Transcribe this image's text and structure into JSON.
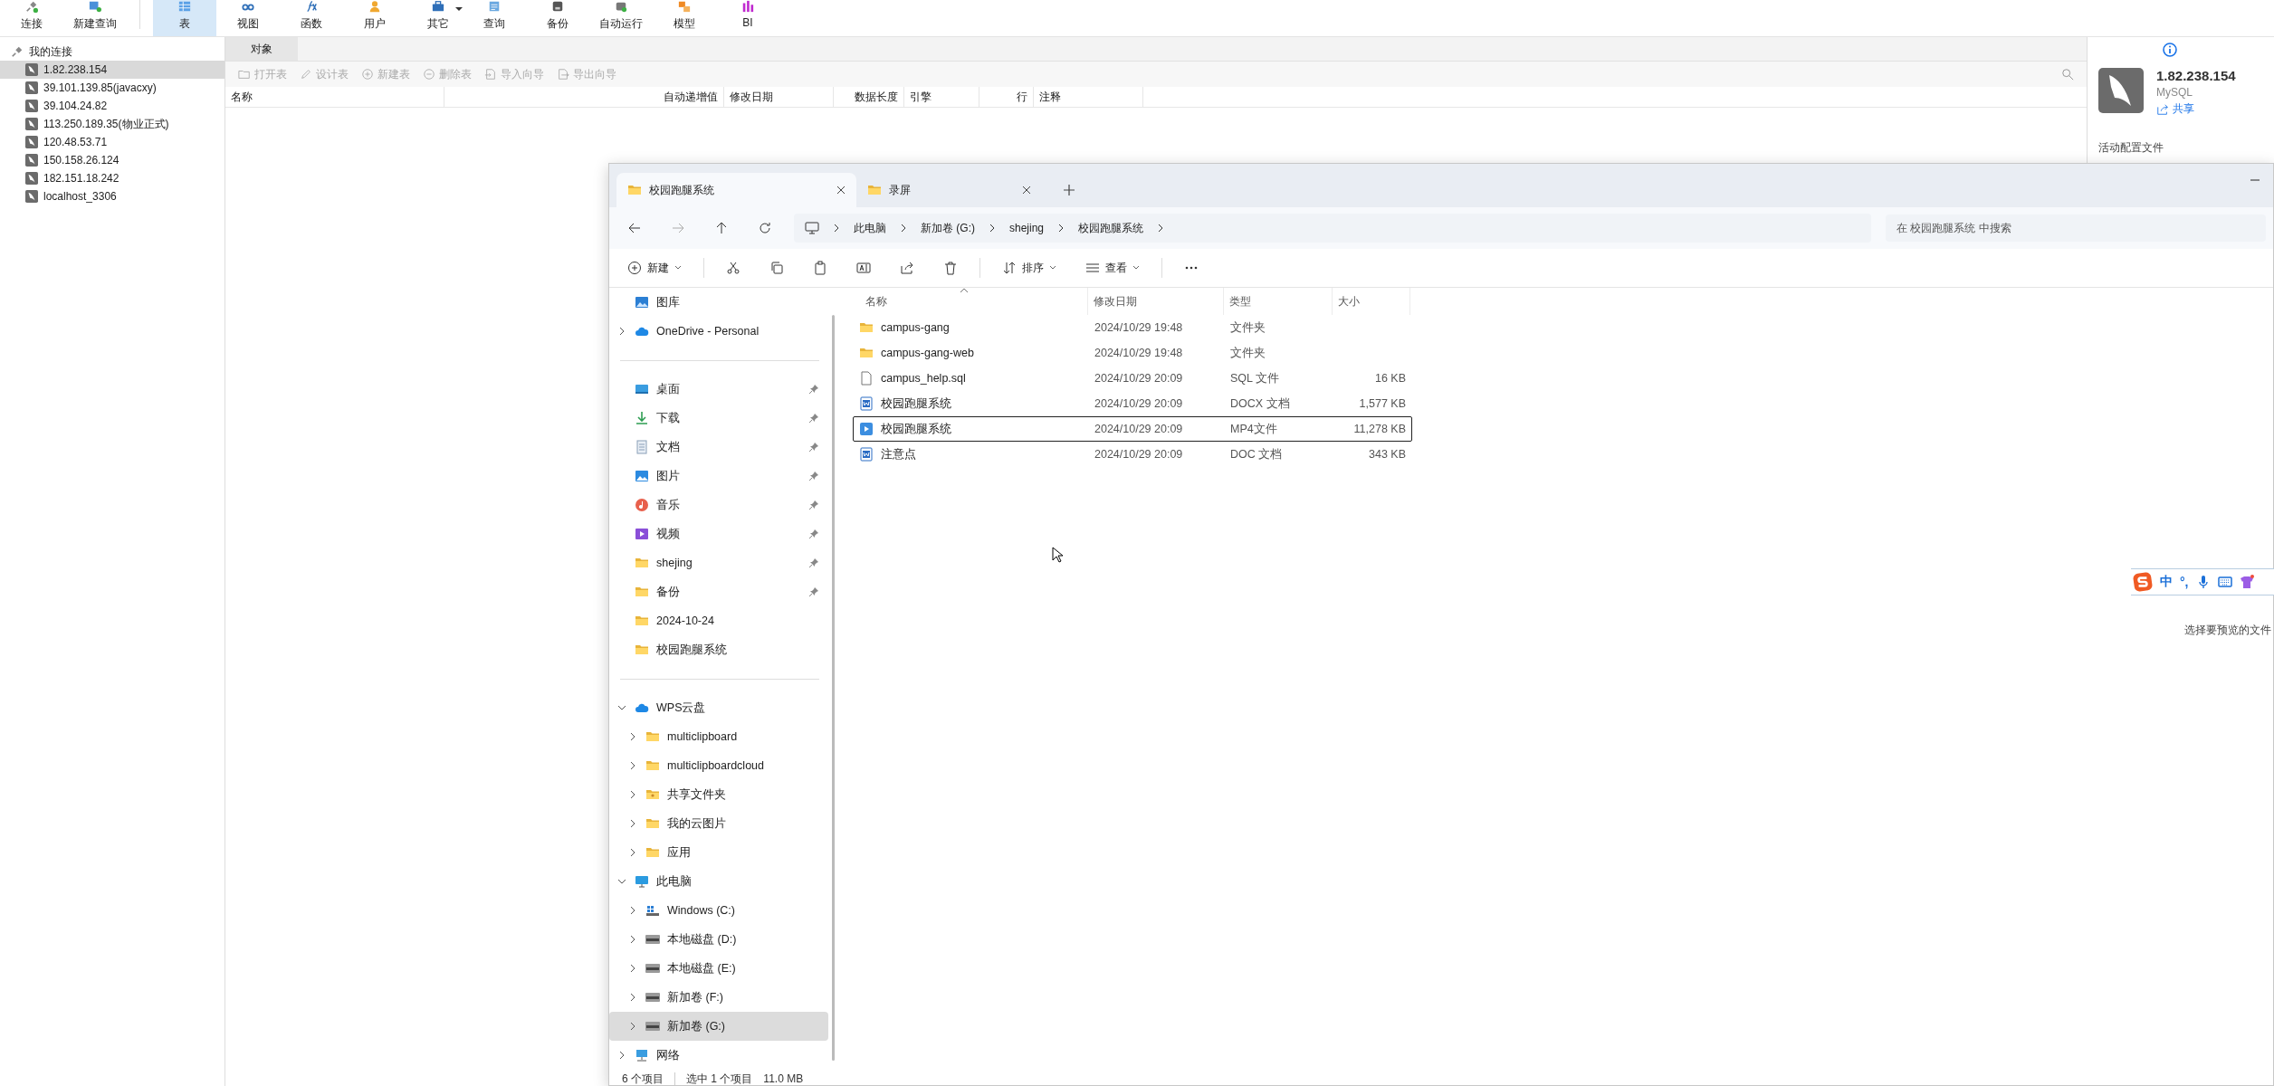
{
  "navicat": {
    "toolbar": [
      {
        "label": "连接",
        "kind": "connect",
        "selected": false,
        "dropdown": false
      },
      {
        "label": "新建查询",
        "kind": "query-new",
        "selected": false,
        "dropdown": false
      },
      {
        "label": "表",
        "kind": "table",
        "selected": true,
        "dropdown": false
      },
      {
        "label": "视图",
        "kind": "view",
        "selected": false,
        "dropdown": false
      },
      {
        "label": "函数",
        "kind": "function",
        "selected": false,
        "dropdown": false
      },
      {
        "label": "用户",
        "kind": "user",
        "selected": false,
        "dropdown": false
      },
      {
        "label": "其它",
        "kind": "other",
        "selected": false,
        "dropdown": true
      },
      {
        "label": "查询",
        "kind": "query",
        "selected": false,
        "dropdown": false
      },
      {
        "label": "备份",
        "kind": "backup",
        "selected": false,
        "dropdown": false
      },
      {
        "label": "自动运行",
        "kind": "auto",
        "selected": false,
        "dropdown": false
      },
      {
        "label": "模型",
        "kind": "model",
        "selected": false,
        "dropdown": false
      },
      {
        "label": "BI",
        "kind": "bi",
        "selected": false,
        "dropdown": false
      }
    ],
    "connections": {
      "title": "我的连接",
      "items": [
        {
          "label": "1.82.238.154",
          "selected": true
        },
        {
          "label": "39.101.139.85(javacxy)",
          "selected": false
        },
        {
          "label": "39.104.24.82",
          "selected": false
        },
        {
          "label": "113.250.189.35(物业正式)",
          "selected": false
        },
        {
          "label": "120.48.53.71",
          "selected": false
        },
        {
          "label": "150.158.26.124",
          "selected": false
        },
        {
          "label": "182.151.18.242",
          "selected": false
        },
        {
          "label": "localhost_3306",
          "selected": false
        }
      ]
    },
    "object_tabs": [
      {
        "label": "对象",
        "selected": true
      }
    ],
    "object_toolbar": [
      {
        "label": "打开表",
        "kind": "open",
        "disabled": true
      },
      {
        "label": "设计表",
        "kind": "design",
        "disabled": true
      },
      {
        "label": "新建表",
        "kind": "add",
        "disabled": true
      },
      {
        "label": "删除表",
        "kind": "remove",
        "disabled": true
      },
      {
        "label": "导入向导",
        "kind": "import",
        "disabled": true
      },
      {
        "label": "导出向导",
        "kind": "export",
        "disabled": true
      }
    ],
    "columns": [
      "名称",
      "自动递增值",
      "修改日期",
      "数据长度",
      "引擎",
      "行",
      "注释"
    ],
    "info_panel": {
      "title": "1.82.238.154",
      "subtitle": "MySQL",
      "share": "共享",
      "section": "活动配置文件"
    }
  },
  "explorer": {
    "tabs": [
      {
        "label": "校园跑腿系统",
        "selected": true
      },
      {
        "label": "录屏",
        "selected": false
      }
    ],
    "breadcrumb": [
      "此电脑",
      "新加卷 (G:)",
      "shejing",
      "校园跑腿系统"
    ],
    "search": {
      "placeholder": "在 校园跑腿系统 中搜索"
    },
    "commands": [
      {
        "kind": "new",
        "label": "新建",
        "dropdown": true
      },
      {
        "kind": "cut",
        "dropdown": false
      },
      {
        "kind": "copy",
        "dropdown": false
      },
      {
        "kind": "paste",
        "dropdown": false
      },
      {
        "kind": "rename",
        "dropdown": false
      },
      {
        "kind": "share",
        "dropdown": false
      },
      {
        "kind": "delete",
        "dropdown": false
      },
      {
        "kind": "sort",
        "label": "排序",
        "dropdown": true
      },
      {
        "kind": "view",
        "label": "查看",
        "dropdown": true
      },
      {
        "kind": "more",
        "dropdown": false
      }
    ],
    "nav": [
      {
        "items": [
          {
            "label": "图库",
            "kind": "gallery",
            "selected": false
          },
          {
            "label": "OneDrive - Personal",
            "kind": "cloud",
            "expanded": false,
            "selected": false
          }
        ]
      },
      {
        "items": [
          {
            "label": "桌面",
            "kind": "desktop",
            "pinned": true,
            "selected": false
          },
          {
            "label": "下载",
            "kind": "download",
            "pinned": true,
            "selected": false
          },
          {
            "label": "文档",
            "kind": "document",
            "pinned": true,
            "selected": false
          },
          {
            "label": "图片",
            "kind": "picture",
            "pinned": true,
            "selected": false
          },
          {
            "label": "音乐",
            "kind": "music",
            "pinned": true,
            "selected": false
          },
          {
            "label": "视频",
            "kind": "video",
            "pinned": true,
            "selected": false
          },
          {
            "label": "shejing",
            "kind": "folder",
            "pinned": true,
            "selected": false
          },
          {
            "label": "备份",
            "kind": "folder",
            "pinned": true,
            "selected": false
          },
          {
            "label": "2024-10-24",
            "kind": "folder",
            "pinned": false,
            "selected": false
          },
          {
            "label": "校园跑腿系统",
            "kind": "folder",
            "pinned": false,
            "selected": false
          }
        ]
      },
      {
        "items": [
          {
            "label": "WPS云盘",
            "kind": "cloud",
            "expanded": true,
            "selected": false,
            "children": [
              {
                "label": "multiclipboard",
                "kind": "folder",
                "expanded": false,
                "selected": false
              },
              {
                "label": "multiclipboardcloud",
                "kind": "folder",
                "expanded": false,
                "selected": false
              },
              {
                "label": "共享文件夹",
                "kind": "shared",
                "expanded": false,
                "selected": false
              },
              {
                "label": "我的云图片",
                "kind": "folder",
                "expanded": false,
                "selected": false
              },
              {
                "label": "应用",
                "kind": "folder",
                "expanded": false,
                "selected": false
              }
            ]
          },
          {
            "label": "此电脑",
            "kind": "pc",
            "expanded": true,
            "selected": false,
            "children": [
              {
                "label": "Windows (C:)",
                "kind": "system-drive",
                "expanded": false,
                "selected": false
              },
              {
                "label": "本地磁盘 (D:)",
                "kind": "drive",
                "expanded": false,
                "selected": false
              },
              {
                "label": "本地磁盘 (E:)",
                "kind": "drive",
                "expanded": false,
                "selected": false
              },
              {
                "label": "新加卷 (F:)",
                "kind": "drive",
                "expanded": false,
                "selected": false
              },
              {
                "label": "新加卷 (G:)",
                "kind": "drive",
                "expanded": false,
                "selected": true
              }
            ]
          },
          {
            "label": "网络",
            "kind": "network",
            "expanded": false,
            "selected": false
          }
        ]
      }
    ],
    "columns": [
      "名称",
      "修改日期",
      "类型",
      "大小"
    ],
    "files": [
      {
        "name": "campus-gang",
        "date": "2024/10/29 19:48",
        "type": "文件夹",
        "kind": "folder",
        "selected": false
      },
      {
        "name": "campus-gang-web",
        "date": "2024/10/29 19:48",
        "type": "文件夹",
        "kind": "folder",
        "selected": false
      },
      {
        "name": "campus_help.sql",
        "date": "2024/10/29 20:09",
        "type": "SQL 文件",
        "size": "16 KB",
        "kind": "file",
        "selected": false
      },
      {
        "name": "校园跑腿系统",
        "date": "2024/10/29 20:09",
        "type": "DOCX 文档",
        "size": "1,577 KB",
        "kind": "word",
        "selected": false
      },
      {
        "name": "校园跑腿系统",
        "date": "2024/10/29 20:09",
        "type": "MP4文件",
        "size": "11,278 KB",
        "kind": "movie",
        "selected": true
      },
      {
        "name": "注意点",
        "date": "2024/10/29 20:09",
        "type": "DOC 文档",
        "size": "343 KB",
        "kind": "word",
        "selected": false
      }
    ],
    "preview_hint": "选择要预览的文件",
    "status": {
      "count": "6 个项目",
      "selection": "选中 1 个项目",
      "size": "11.0 MB"
    }
  },
  "ime": {
    "mode": "中",
    "punct": "°,"
  }
}
